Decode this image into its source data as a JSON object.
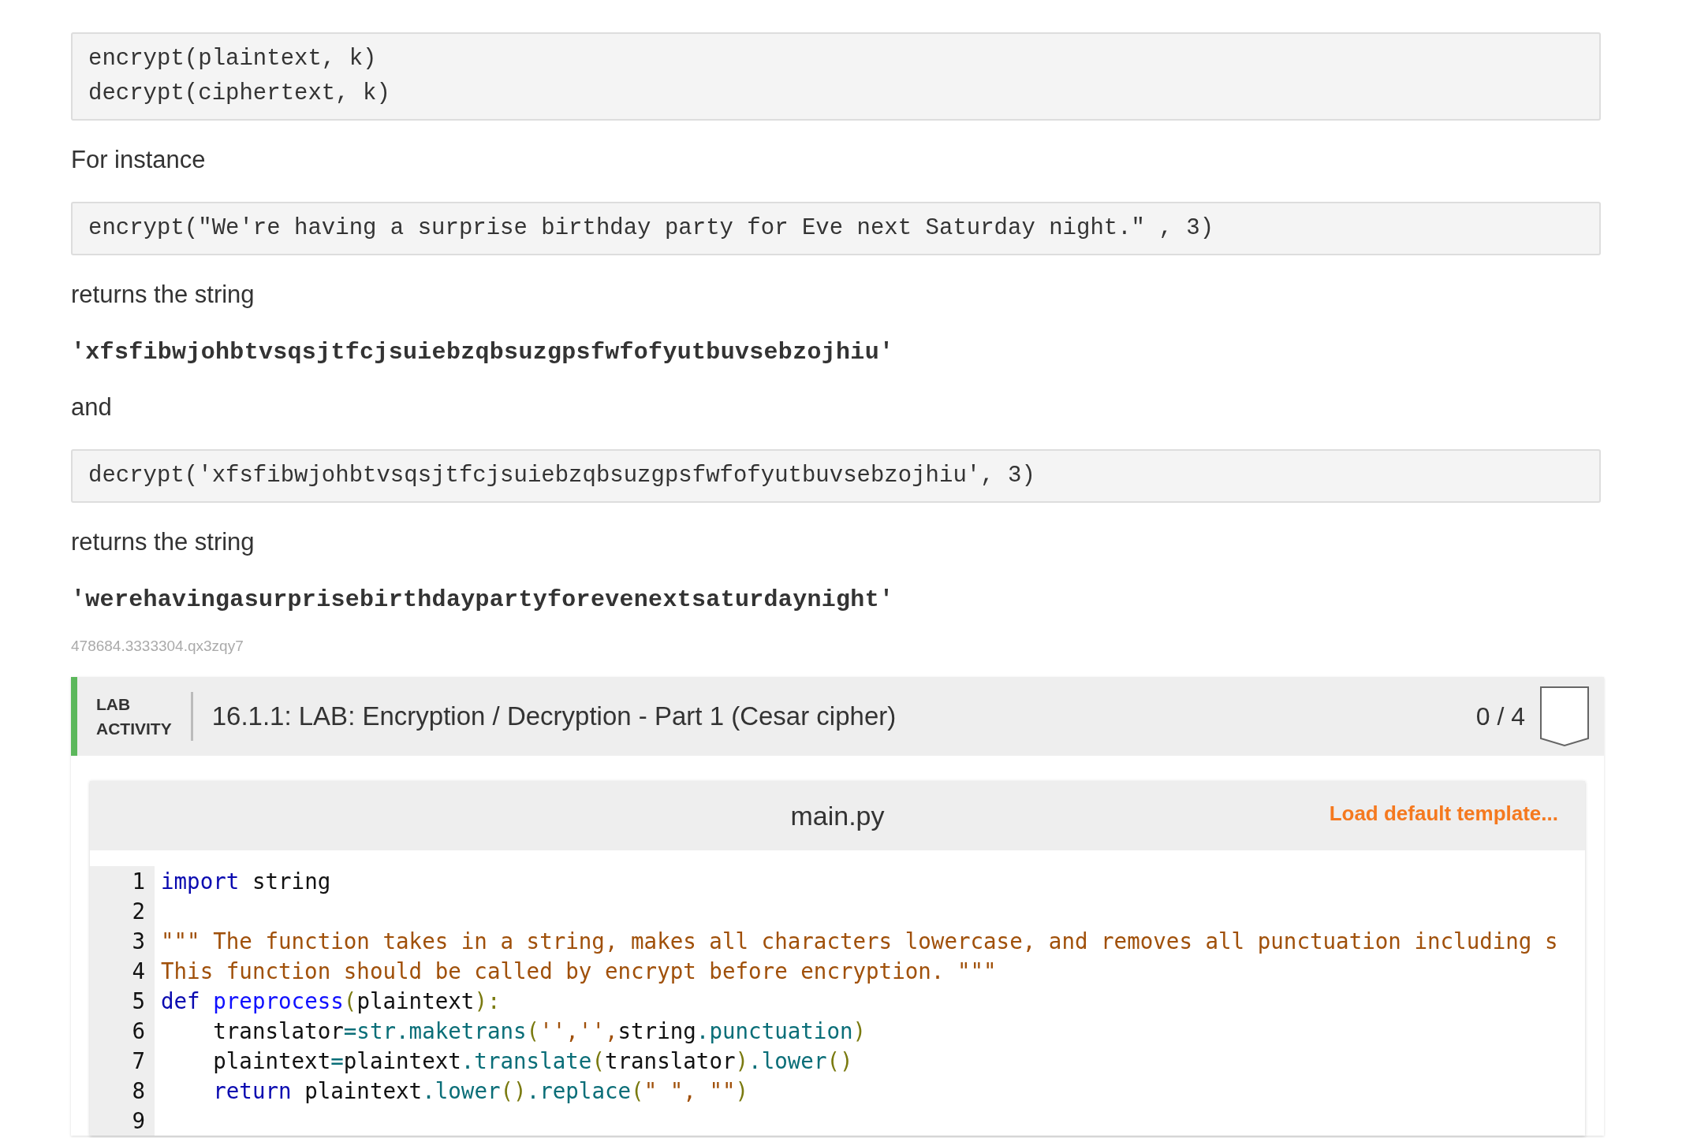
{
  "signature_block": [
    "encrypt(plaintext, k)",
    "decrypt(ciphertext, k)"
  ],
  "sections": [
    {
      "kind": "text",
      "text": "For instance"
    },
    {
      "kind": "code",
      "text": "encrypt(\"We're having a surprise birthday party for Eve next Saturday night.\" , 3)"
    },
    {
      "kind": "text",
      "text": "returns the string"
    },
    {
      "kind": "output",
      "text": "'xfsfibwjohbtvsqsjtfcjsuiebzqbsuzgpsfwfofyutbuvsebzojhiu'"
    },
    {
      "kind": "text",
      "text": "and"
    },
    {
      "kind": "code",
      "text": "decrypt('xfsfibwjohbtvsqsjtfcjsuiebzqbsuzgpsfwfofyutbuvsebzojhiu', 3)"
    },
    {
      "kind": "text",
      "text": "returns the string"
    },
    {
      "kind": "output",
      "text": "'werehavingasurprisebirthdaypartyforevenextsaturdaynight'"
    },
    {
      "kind": "id",
      "text": "478684.3333304.qx3zqy7"
    }
  ],
  "lab": {
    "label_lines": [
      "LAB",
      "ACTIVITY"
    ],
    "title": "16.1.1: LAB: Encryption / Decryption - Part 1 (Cesar cipher)",
    "score": "0 / 4"
  },
  "editor": {
    "filename": "main.py",
    "load_button": "Load default template...",
    "lines": [
      {
        "number": "1",
        "tokens": [
          {
            "kind": "keyword",
            "text": "import"
          },
          {
            "kind": "plain",
            "text": " string"
          }
        ]
      },
      {
        "number": "2"
      },
      {
        "number": "3",
        "tokens": [
          {
            "kind": "string",
            "text": "\"\"\" The function takes in a string, makes all characters lowercase, and removes all punctuation including s"
          }
        ]
      },
      {
        "number": "4",
        "tokens": [
          {
            "kind": "string",
            "text": "This function should be called by encrypt before encryption. \"\"\""
          }
        ]
      },
      {
        "number": "5",
        "tokens": [
          {
            "kind": "keyword",
            "text": "def "
          },
          {
            "kind": "defname",
            "text": "preprocess"
          },
          {
            "kind": "paren",
            "text": "("
          },
          {
            "kind": "plain",
            "text": "plaintext"
          },
          {
            "kind": "paren",
            "text": "):"
          }
        ]
      },
      {
        "number": "6",
        "tokens": [
          {
            "kind": "plain",
            "text": "    translator"
          },
          {
            "kind": "op",
            "text": "="
          },
          {
            "kind": "method",
            "text": "str.maketrans"
          },
          {
            "kind": "paren",
            "text": "("
          },
          {
            "kind": "string",
            "text": "'','',"
          },
          {
            "kind": "plain",
            "text": "string"
          },
          {
            "kind": "method",
            "text": ".punctuation"
          },
          {
            "kind": "paren",
            "text": ")"
          }
        ]
      },
      {
        "number": "7",
        "tokens": [
          {
            "kind": "plain",
            "text": "    plaintext"
          },
          {
            "kind": "op",
            "text": "="
          },
          {
            "kind": "plain",
            "text": "plaintext"
          },
          {
            "kind": "method",
            "text": ".translate"
          },
          {
            "kind": "paren",
            "text": "("
          },
          {
            "kind": "plain",
            "text": "translator"
          },
          {
            "kind": "paren",
            "text": ")"
          },
          {
            "kind": "method",
            "text": ".lower"
          },
          {
            "kind": "paren",
            "text": "()"
          }
        ]
      },
      {
        "number": "8",
        "tokens": [
          {
            "kind": "keyword",
            "text": "    return"
          },
          {
            "kind": "plain",
            "text": " plaintext"
          },
          {
            "kind": "method",
            "text": ".lower"
          },
          {
            "kind": "paren",
            "text": "()"
          },
          {
            "kind": "method",
            "text": ".replace"
          },
          {
            "kind": "paren",
            "text": "("
          },
          {
            "kind": "string",
            "text": "\" \", \"\""
          },
          {
            "kind": "paren",
            "text": ")"
          }
        ]
      },
      {
        "number": "9"
      }
    ]
  }
}
